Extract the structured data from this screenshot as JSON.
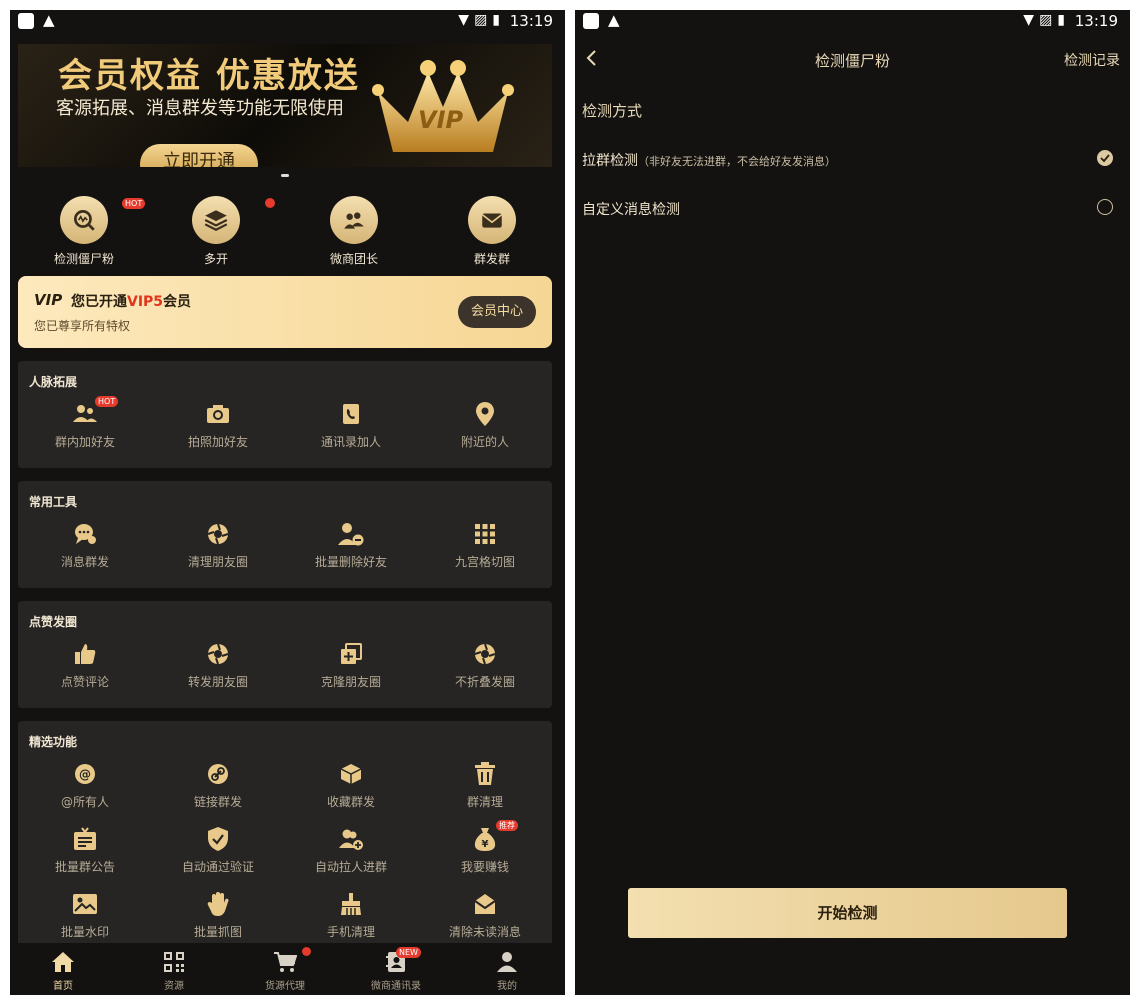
{
  "status_bar": {
    "time": "13:19"
  },
  "left": {
    "banner": {
      "title": "会员权益 优惠放送",
      "subtitle": "客源拓展、消息群发等功能无限使用",
      "button": "立即开通",
      "crown_text": "VIP"
    },
    "top_icons": [
      {
        "label": "检测僵尸粉",
        "icon": "zombie-detect-icon",
        "badge": "HOT"
      },
      {
        "label": "多开",
        "icon": "layers-icon",
        "badge": ""
      },
      {
        "label": "微商团长",
        "icon": "leader-icon",
        "badge": ""
      },
      {
        "label": "群发群",
        "icon": "mail-icon",
        "badge": ""
      }
    ],
    "vip_card": {
      "logo": "VIP",
      "title_prefix": "您已开通",
      "level": "VIP5",
      "title_suffix": "会员",
      "subtitle": "您已尊享所有特权",
      "button": "会员中心"
    },
    "sections": [
      {
        "title": "人脉拓展",
        "items": [
          {
            "label": "群内加好友",
            "icon": "group-add-icon",
            "badge": "HOT"
          },
          {
            "label": "拍照加好友",
            "icon": "camera-icon"
          },
          {
            "label": "通讯录加人",
            "icon": "contacts-icon"
          },
          {
            "label": "附近的人",
            "icon": "location-icon"
          }
        ]
      },
      {
        "title": "常用工具",
        "items": [
          {
            "label": "消息群发",
            "icon": "chat-bubble-icon"
          },
          {
            "label": "清理朋友圈",
            "icon": "aperture-icon"
          },
          {
            "label": "批量删除好友",
            "icon": "remove-user-icon"
          },
          {
            "label": "九宫格切图",
            "icon": "grid-icon"
          }
        ]
      },
      {
        "title": "点赞发圈",
        "items": [
          {
            "label": "点赞评论",
            "icon": "thumbs-up-icon"
          },
          {
            "label": "转发朋友圈",
            "icon": "aperture-icon"
          },
          {
            "label": "克隆朋友圈",
            "icon": "clone-icon"
          },
          {
            "label": "不折叠发圈",
            "icon": "aperture-icon"
          }
        ]
      },
      {
        "title": "精选功能",
        "items": [
          {
            "label": "@所有人",
            "icon": "at-icon"
          },
          {
            "label": "链接群发",
            "icon": "link-icon"
          },
          {
            "label": "收藏群发",
            "icon": "box-icon"
          },
          {
            "label": "群清理",
            "icon": "trash-icon"
          },
          {
            "label": "批量群公告",
            "icon": "notice-icon"
          },
          {
            "label": "自动通过验证",
            "icon": "shield-check-icon"
          },
          {
            "label": "自动拉人进群",
            "icon": "add-people-icon"
          },
          {
            "label": "我要赚钱",
            "icon": "money-bag-icon",
            "badge": "推荐"
          },
          {
            "label": "批量水印",
            "icon": "image-icon"
          },
          {
            "label": "批量抓图",
            "icon": "hand-icon"
          },
          {
            "label": "手机清理",
            "icon": "brush-icon"
          },
          {
            "label": "清除未读消息",
            "icon": "envelope-open-icon"
          }
        ]
      }
    ],
    "bottom_nav": [
      {
        "label": "首页",
        "icon": "home-icon",
        "active": true
      },
      {
        "label": "资源",
        "icon": "qr-icon",
        "active": false
      },
      {
        "label": "货源代理",
        "icon": "cart-icon",
        "active": false
      },
      {
        "label": "微商通讯录",
        "icon": "address-book-icon",
        "active": false,
        "badge": "NEW"
      },
      {
        "label": "我的",
        "icon": "person-icon",
        "active": false
      }
    ]
  },
  "right": {
    "title": "检测僵尸粉",
    "action": "检测记录",
    "method_label": "检测方式",
    "options": [
      {
        "label": "拉群检测",
        "note": "（非好友无法进群，不会给好友发消息）",
        "selected": true
      },
      {
        "label": "自定义消息检测",
        "note": "",
        "selected": false
      }
    ],
    "start_button": "开始检测"
  },
  "colors": {
    "accent_gold": "#e8c98a",
    "background": "#141210",
    "card": "#262523",
    "red": "#e53b2c"
  }
}
